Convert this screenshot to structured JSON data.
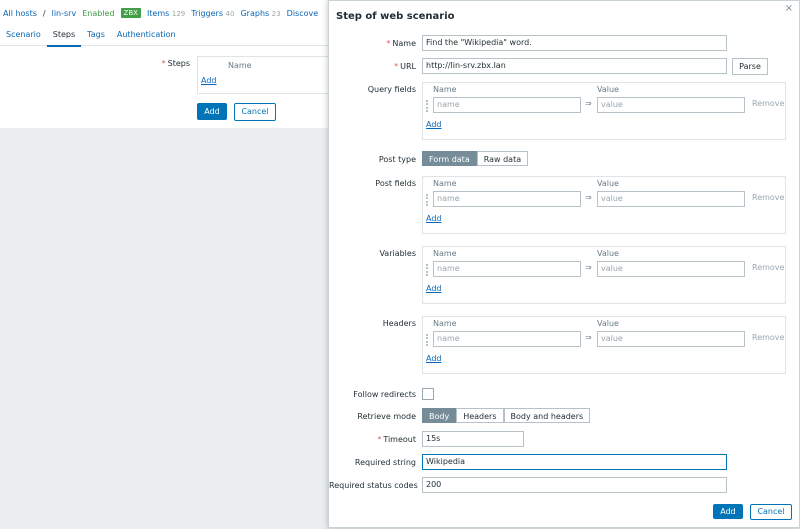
{
  "background": {
    "breadcrumbs": {
      "all_hosts": "All hosts",
      "sep": "/",
      "host": "lin-srv",
      "status": "Enabled",
      "zbx": "ZBX",
      "items": "Items",
      "items_count": "129",
      "triggers": "Triggers",
      "triggers_count": "40",
      "graphs": "Graphs",
      "graphs_count": "23",
      "discovery": "Discove"
    },
    "tabs": [
      "Scenario",
      "Steps",
      "Tags",
      "Authentication"
    ],
    "steps_label": "Steps",
    "steps_col_name": "Name",
    "steps_add": "Add",
    "add_button": "Add",
    "cancel_button": "Cancel"
  },
  "dialog": {
    "title": "Step of web scenario",
    "close": "×",
    "name_label": "Name",
    "name_value": "Find the \"Wikipedia\" word.",
    "url_label": "URL",
    "url_value": "http://lin-srv.zbx.lan",
    "parse_button": "Parse",
    "query_fields_label": "Query fields",
    "post_type_label": "Post type",
    "post_type_options": [
      "Form data",
      "Raw data"
    ],
    "post_fields_label": "Post fields",
    "variables_label": "Variables",
    "headers_label": "Headers",
    "pair": {
      "col_name": "Name",
      "col_value": "Value",
      "name_placeholder": "name",
      "value_placeholder": "value",
      "arrow": "⇒",
      "remove": "Remove",
      "add": "Add"
    },
    "follow_redirects_label": "Follow redirects",
    "follow_redirects_checked": false,
    "retrieve_mode_label": "Retrieve mode",
    "retrieve_mode_options": [
      "Body",
      "Headers",
      "Body and headers"
    ],
    "timeout_label": "Timeout",
    "timeout_value": "15s",
    "required_string_label": "Required string",
    "required_string_value": "Wikipedia",
    "required_status_label": "Required status codes",
    "required_status_value": "200",
    "add_button": "Add",
    "cancel_button": "Cancel"
  },
  "colors": {
    "accent": "#0275b8",
    "link": "#0a66b7",
    "required": "#e45959",
    "enabled": "#429e47"
  }
}
